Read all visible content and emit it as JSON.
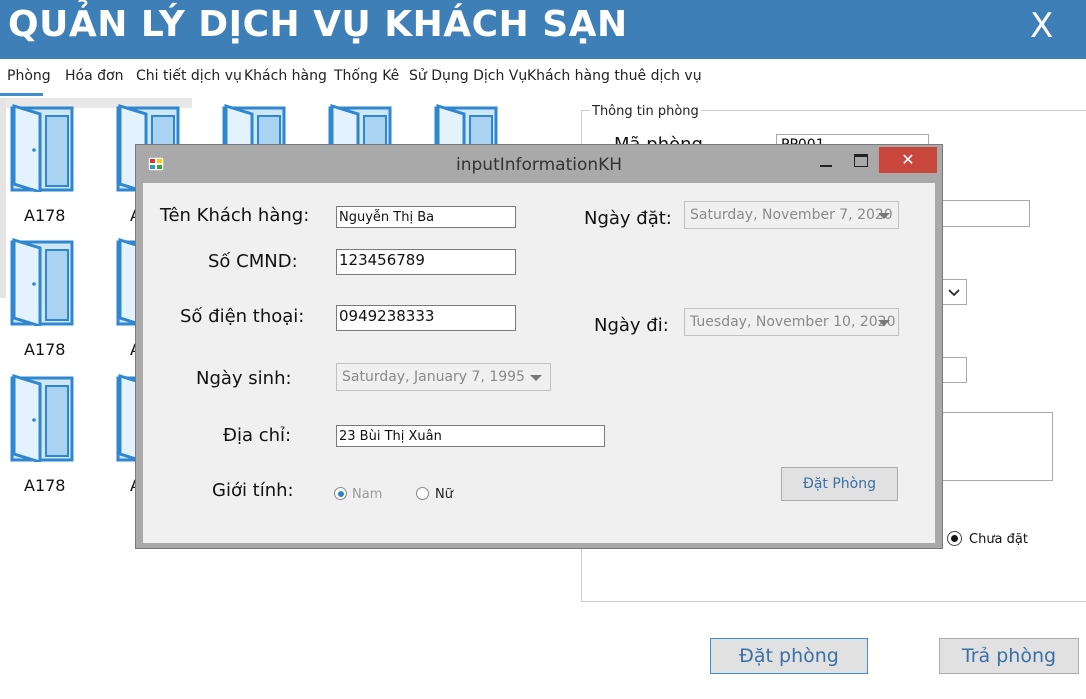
{
  "app": {
    "title": "QUẢN LÝ DỊCH VỤ KHÁCH SẠN",
    "close_label": "X"
  },
  "menu": [
    {
      "label": "Phòng"
    },
    {
      "label": "Hóa đơn"
    },
    {
      "label": "Chi tiết dịch vụ"
    },
    {
      "label": "Khách hàng"
    },
    {
      "label": "Thống Kê"
    },
    {
      "label": "Sử Dụng Dịch Vụ"
    },
    {
      "label": "Khách hàng thuê dịch vụ"
    }
  ],
  "rooms": [
    {
      "label": "A178"
    },
    {
      "label": "A"
    },
    {
      "label": "A178"
    },
    {
      "label": "A"
    },
    {
      "label": "A178"
    },
    {
      "label": "A"
    }
  ],
  "right_panel": {
    "group_title": "Thông tin phòng",
    "room_code_label": "Mã phòng",
    "room_code_value": "PP001",
    "status_option": "Chưa đặt"
  },
  "bottom_buttons": {
    "book": "Đặt phòng",
    "return": "Trả phòng"
  },
  "dialog": {
    "title": "inputInformationKH",
    "close_glyph": "✕",
    "fields": {
      "name_label": "Tên Khách hàng:",
      "name_value": "Nguyễn Thị Ba",
      "id_label": "Số CMND:",
      "id_value": "123456789",
      "phone_label": "Số điện thoại:",
      "phone_value": "0949238333",
      "birth_label": "Ngày sinh:",
      "birth_value": "Saturday, January 7, 1995",
      "address_label": "Địa chỉ:",
      "address_value": "23 Bùi Thị Xuân",
      "gender_label": "Giới tính:",
      "gender_male": "Nam",
      "gender_female": "Nữ",
      "gender_selected": "Nam",
      "booking_date_label": "Ngày đặt:",
      "booking_date_value": "Saturday, November 7, 2020",
      "leave_date_label": "Ngày đi:",
      "leave_date_value": "Tuesday, November 10, 2020"
    },
    "submit_label": "Đặt Phòng"
  }
}
